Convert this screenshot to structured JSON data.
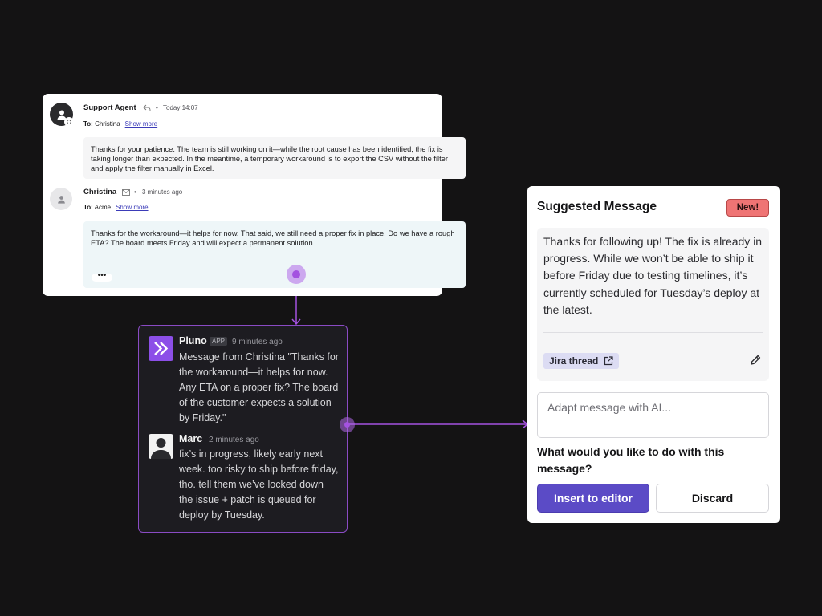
{
  "ticket": {
    "messages": [
      {
        "sender": "Support Agent",
        "time": "Today 14:07",
        "to_label": "To:",
        "to": "Christina",
        "show_more": "Show more",
        "body": "Thanks for your patience. The team is still working on it—while the root cause has been identified, the fix is taking longer than expected. In the meantime, a temporary workaround is to export the CSV without the filter and apply the filter manually in Excel."
      },
      {
        "sender": "Christina",
        "time": "3 minutes ago",
        "to_label": "To:",
        "to": "Acme",
        "show_more": "Show more",
        "body": "Thanks for the workaround—it helps for now. That said, we still need a proper fix in place. Do we have a rough ETA? The board meets Friday and will expect a permanent solution.",
        "more": "•••"
      }
    ]
  },
  "slack": {
    "messages": [
      {
        "name": "Pluno",
        "badge": "APP",
        "time": "9 minutes ago",
        "text": "Message from Christina \"Thanks for the workaround—it helps for now. Any ETA on a proper fix? The board of the customer expects a solution by Friday.\""
      },
      {
        "name": "Marc",
        "time": "2 minutes ago",
        "text": "fix’s in progress, likely early next week. too risky to ship before friday, tho. tell them we’ve locked down the issue + patch is queued for deploy by Tuesday."
      }
    ]
  },
  "suggestion": {
    "title": "Suggested Message",
    "badge": "New!",
    "body": "Thanks for following up! The fix is already in progress. While we won’t be able to ship it before Friday due to testing timelines, it’s currently scheduled for Tuesday’s deploy at the latest.",
    "jira_label": "Jira thread",
    "adapt_placeholder": "Adapt message with AI...",
    "question": "What would you like to do with this message?",
    "insert_label": "Insert to editor",
    "discard_label": "Discard"
  },
  "colors": {
    "background": "#141314",
    "connector": "#a452e0",
    "primary_button": "#5b4bc6",
    "badge": "#ef7474",
    "pluno_brand": "#8c4fe8"
  },
  "icons": [
    "user-icon",
    "headset-icon",
    "reply-icon",
    "email-icon",
    "pluno-logo-icon",
    "external-link-icon",
    "pencil-icon"
  ]
}
